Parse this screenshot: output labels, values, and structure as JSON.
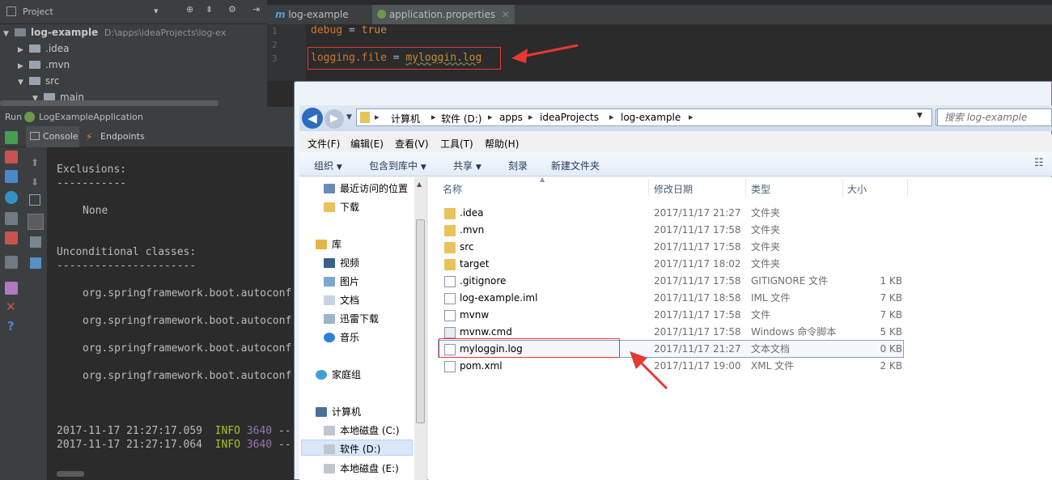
{
  "project_panel": {
    "title": "Project",
    "tree": [
      {
        "label": "log-example",
        "path": "D:\\apps\\ideaProjects\\log-ex"
      },
      {
        "label": ".idea"
      },
      {
        "label": ".mvn"
      },
      {
        "label": "src"
      },
      {
        "label": "main"
      }
    ]
  },
  "editor": {
    "tabs": [
      {
        "label": "log-example"
      },
      {
        "label": "application.properties"
      }
    ],
    "line_numbers": [
      "1",
      "2",
      "3"
    ],
    "lines": [
      {
        "key": "debug",
        "op": "=",
        "value": "true"
      },
      {
        "key": "logging.file",
        "op": "=",
        "value": "myloggin.log"
      }
    ]
  },
  "run_panel": {
    "label": "Run",
    "config": "LogExampleApplication",
    "tabs": [
      "Console",
      "Endpoints"
    ],
    "console_lines": [
      "Exclusions:",
      "-----------",
      "None",
      "Unconditional classes:",
      "----------------------",
      "org.springframework.boot.autoconf",
      "org.springframework.boot.autoconf",
      "org.springframework.boot.autoconf",
      "org.springframework.boot.autoconf"
    ],
    "log_lines": [
      {
        "time": "2017-11-17 21:27:17.059",
        "level": "INFO",
        "pid": "3640",
        "rest": "--"
      },
      {
        "time": "2017-11-17 21:27:17.064",
        "level": "INFO",
        "pid": "3640",
        "rest": "--"
      }
    ]
  },
  "explorer": {
    "breadcrumb": [
      "计算机",
      "软件 (D:)",
      "apps",
      "ideaProjects",
      "log-example"
    ],
    "search_placeholder": "搜索 log-example",
    "menu": [
      "文件(F)",
      "编辑(E)",
      "查看(V)",
      "工具(T)",
      "帮助(H)"
    ],
    "toolbar": [
      "组织",
      "包含到库中",
      "共享",
      "刻录",
      "新建文件夹"
    ],
    "nav": [
      {
        "label": "最近访问的位置",
        "icon": "recent-places-icon"
      },
      {
        "label": "下载",
        "icon": "downloads-folder-icon"
      },
      {
        "label": "库",
        "icon": "library-icon"
      },
      {
        "label": "视频",
        "icon": "video-library-icon"
      },
      {
        "label": "图片",
        "icon": "pictures-library-icon"
      },
      {
        "label": "文档",
        "icon": "documents-library-icon"
      },
      {
        "label": "迅雷下载",
        "icon": "thunder-download-icon"
      },
      {
        "label": "音乐",
        "icon": "music-library-icon"
      },
      {
        "label": "家庭组",
        "icon": "homegroup-icon"
      },
      {
        "label": "计算机",
        "icon": "computer-icon"
      },
      {
        "label": "本地磁盘 (C:)",
        "icon": "drive-c-icon"
      },
      {
        "label": "软件 (D:)",
        "icon": "drive-d-icon"
      },
      {
        "label": "本地磁盘 (E:)",
        "icon": "drive-e-icon"
      }
    ],
    "columns": [
      "名称",
      "修改日期",
      "类型",
      "大小"
    ],
    "files": [
      {
        "name": ".idea",
        "date": "2017/11/17 21:27",
        "type": "文件夹",
        "size": "",
        "kind": "folder"
      },
      {
        "name": ".mvn",
        "date": "2017/11/17 17:58",
        "type": "文件夹",
        "size": "",
        "kind": "folder"
      },
      {
        "name": "src",
        "date": "2017/11/17 17:58",
        "type": "文件夹",
        "size": "",
        "kind": "folder"
      },
      {
        "name": "target",
        "date": "2017/11/17 18:02",
        "type": "文件夹",
        "size": "",
        "kind": "folder"
      },
      {
        "name": ".gitignore",
        "date": "2017/11/17 17:58",
        "type": "GITIGNORE 文件",
        "size": "1 KB",
        "kind": "doc"
      },
      {
        "name": "log-example.iml",
        "date": "2017/11/17 18:58",
        "type": "IML 文件",
        "size": "7 KB",
        "kind": "doc"
      },
      {
        "name": "mvnw",
        "date": "2017/11/17 17:58",
        "type": "文件",
        "size": "7 KB",
        "kind": "doc"
      },
      {
        "name": "mvnw.cmd",
        "date": "2017/11/17 17:58",
        "type": "Windows 命令脚本",
        "size": "5 KB",
        "kind": "doc"
      },
      {
        "name": "myloggin.log",
        "date": "2017/11/17 21:27",
        "type": "文本文档",
        "size": "0 KB",
        "kind": "doc"
      },
      {
        "name": "pom.xml",
        "date": "2017/11/17 19:00",
        "type": "XML 文件",
        "size": "2 KB",
        "kind": "doc"
      }
    ]
  },
  "colors": {
    "annotation": "#e53935",
    "keyword": "#cc7832",
    "string": "#6a8759",
    "value": "#c98c3a"
  }
}
